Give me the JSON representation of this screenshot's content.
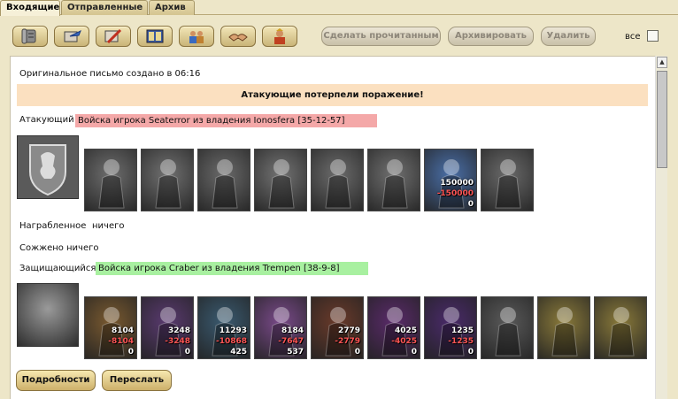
{
  "tabs": [
    {
      "label": "Входящие",
      "active": true
    },
    {
      "label": "Отправленные",
      "active": false
    },
    {
      "label": "Архив",
      "active": false
    }
  ],
  "toolbar": {
    "icons": [
      "scroll-icon",
      "arrow-scroll-icon",
      "sword-icon",
      "book-icon",
      "merchants-icon",
      "handshake-icon",
      "hero-icon"
    ],
    "mark_read_label": "Сделать прочитанным",
    "archive_label": "Архивировать",
    "delete_label": "Удалить",
    "all_label": "все"
  },
  "message": {
    "created_line": "Оригинальное письмо создано в 06:16",
    "result": "Атакующие потерпели поражение!",
    "attacker_label": "Атакующий",
    "attacker_army": "Войска игрока Seaterror из владения Ionosfera [35-12-57]",
    "looted_label": "Награбленное",
    "looted_value": "ничего",
    "burned_label": "Сожжено",
    "burned_value": "ничего",
    "defender_label": "Защищающийся",
    "defender_army": "Войска игрока Craber из владения Trempen [38-9-8]"
  },
  "attacker_units": [
    {
      "icon": "knight-icon",
      "color": "#6e6e6e"
    },
    {
      "icon": "cavalier-icon",
      "color": "#717171"
    },
    {
      "icon": "horseman-icon",
      "color": "#6a6a6a"
    },
    {
      "icon": "pegasus-icon",
      "color": "#737373"
    },
    {
      "icon": "crossbowman-icon",
      "color": "#6c6c6c"
    },
    {
      "icon": "monk-icon",
      "color": "#707070"
    },
    {
      "icon": "angel-icon",
      "color": "#4a6fa8",
      "count": "150000",
      "lost": "-150000",
      "left": "0"
    },
    {
      "icon": "ghost-icon",
      "color": "#6a6a6a"
    }
  ],
  "defender_units": [
    {
      "icon": "dragon-emblem-icon",
      "color": "#555555"
    },
    {
      "icon": "troglodyte-icon",
      "color": "#7a5a30",
      "count": "8104",
      "lost": "-8104",
      "left": "0"
    },
    {
      "icon": "assassin-icon",
      "color": "#5a3a70",
      "count": "3248",
      "lost": "-3248",
      "left": "0"
    },
    {
      "icon": "minotaur-icon",
      "color": "#3a5a70",
      "count": "11293",
      "lost": "-10868",
      "left": "425"
    },
    {
      "icon": "harpy-icon",
      "color": "#7a4a8a",
      "count": "8184",
      "lost": "-7647",
      "left": "537"
    },
    {
      "icon": "dark-archer-icon",
      "color": "#6a3a2a",
      "count": "2779",
      "lost": "-2779",
      "left": "0"
    },
    {
      "icon": "warlock-icon",
      "color": "#5a2a6a",
      "count": "4025",
      "lost": "-4025",
      "left": "0"
    },
    {
      "icon": "shadow-witch-icon",
      "color": "#4a2a6a",
      "count": "1235",
      "lost": "-1235",
      "left": "0"
    },
    {
      "icon": "spider-icon",
      "color": "#5a5a5a"
    },
    {
      "icon": "pink-orb-icon",
      "color": "#8a7a3a"
    },
    {
      "icon": "pink-orb-icon",
      "color": "#8a7a3a"
    }
  ],
  "actions": {
    "details_label": "Подробности",
    "forward_label": "Переслать"
  }
}
